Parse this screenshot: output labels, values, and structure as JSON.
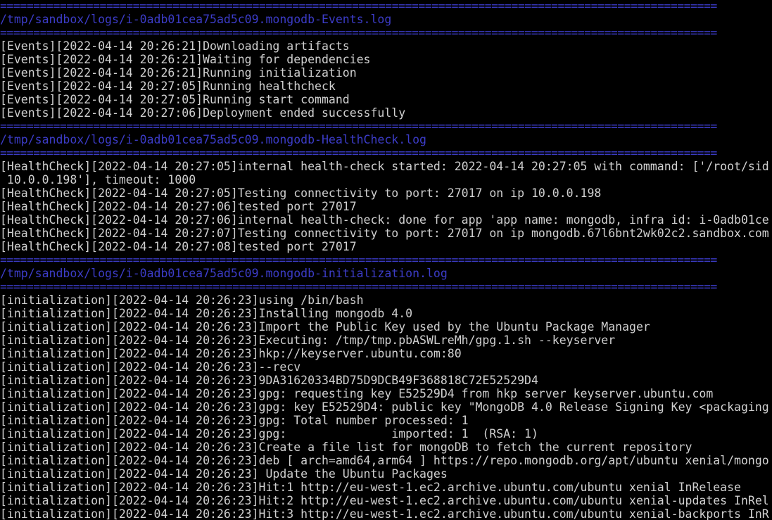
{
  "terminal": {
    "separator": "============================================================================================================",
    "lines": [
      {
        "type": "sep"
      },
      {
        "type": "path",
        "text": "/tmp/sandbox/logs/i-0adb01cea75ad5c09.mongodb-Events.log"
      },
      {
        "type": "sep"
      },
      {
        "type": "text",
        "text": "[Events][2022-04-14 20:26:21]Downloading artifacts"
      },
      {
        "type": "text",
        "text": "[Events][2022-04-14 20:26:21]Waiting for dependencies"
      },
      {
        "type": "text",
        "text": "[Events][2022-04-14 20:26:21]Running initialization"
      },
      {
        "type": "text",
        "text": "[Events][2022-04-14 20:27:05]Running healthcheck"
      },
      {
        "type": "text",
        "text": "[Events][2022-04-14 20:27:05]Running start command"
      },
      {
        "type": "text",
        "text": "[Events][2022-04-14 20:27:06]Deployment ended successfully"
      },
      {
        "type": "sep"
      },
      {
        "type": "path",
        "text": "/tmp/sandbox/logs/i-0adb01cea75ad5c09.mongodb-HealthCheck.log"
      },
      {
        "type": "sep"
      },
      {
        "type": "text",
        "text": "[HealthCheck][2022-04-14 20:27:05]internal health-check started: 2022-04-14 20:27:05 with command: ['/root/sid"
      },
      {
        "type": "text",
        "text": " 10.0.0.198'], timeout: 1000"
      },
      {
        "type": "text",
        "text": "[HealthCheck][2022-04-14 20:27:05]Testing connectivity to port: 27017 on ip 10.0.0.198"
      },
      {
        "type": "text",
        "text": "[HealthCheck][2022-04-14 20:27:06]tested port 27017"
      },
      {
        "type": "text",
        "text": "[HealthCheck][2022-04-14 20:27:06]internal health-check: done for app 'app name: mongodb, infra id: i-0adb01ce"
      },
      {
        "type": "text",
        "text": "[HealthCheck][2022-04-14 20:27:07]Testing connectivity to port: 27017 on ip mongodb.67l6bnt2wk02c2.sandbox.com"
      },
      {
        "type": "text",
        "text": "[HealthCheck][2022-04-14 20:27:08]tested port 27017"
      },
      {
        "type": "sep"
      },
      {
        "type": "path",
        "text": "/tmp/sandbox/logs/i-0adb01cea75ad5c09.mongodb-initialization.log"
      },
      {
        "type": "sep"
      },
      {
        "type": "text",
        "text": "[initialization][2022-04-14 20:26:23]using /bin/bash"
      },
      {
        "type": "text",
        "text": "[initialization][2022-04-14 20:26:23]Installing mongodb 4.0"
      },
      {
        "type": "text",
        "text": "[initialization][2022-04-14 20:26:23]Import the Public Key used by the Ubuntu Package Manager"
      },
      {
        "type": "text",
        "text": "[initialization][2022-04-14 20:26:23]Executing: /tmp/tmp.pbASWLreMh/gpg.1.sh --keyserver"
      },
      {
        "type": "text",
        "text": "[initialization][2022-04-14 20:26:23]hkp://keyserver.ubuntu.com:80"
      },
      {
        "type": "text",
        "text": "[initialization][2022-04-14 20:26:23]--recv"
      },
      {
        "type": "text",
        "text": "[initialization][2022-04-14 20:26:23]9DA31620334BD75D9DCB49F368818C72E52529D4"
      },
      {
        "type": "text",
        "text": "[initialization][2022-04-14 20:26:23]gpg: requesting key E52529D4 from hkp server keyserver.ubuntu.com"
      },
      {
        "type": "text",
        "text": "[initialization][2022-04-14 20:26:23]gpg: key E52529D4: public key \"MongoDB 4.0 Release Signing Key <packaging"
      },
      {
        "type": "text",
        "text": "[initialization][2022-04-14 20:26:23]gpg: Total number processed: 1"
      },
      {
        "type": "text",
        "text": "[initialization][2022-04-14 20:26:23]gpg:               imported: 1  (RSA: 1)"
      },
      {
        "type": "text",
        "text": "[initialization][2022-04-14 20:26:23]Create a file list for mongoDB to fetch the current repository"
      },
      {
        "type": "text",
        "text": "[initialization][2022-04-14 20:26:23]deb [ arch=amd64,arm64 ] https://repo.mongodb.org/apt/ubuntu xenial/mongo"
      },
      {
        "type": "text",
        "text": "[initialization][2022-04-14 20:26:23] Update the Ubuntu Packages"
      },
      {
        "type": "text",
        "text": "[initialization][2022-04-14 20:26:23]Hit:1 http://eu-west-1.ec2.archive.ubuntu.com/ubuntu xenial InRelease"
      },
      {
        "type": "text",
        "text": "[initialization][2022-04-14 20:26:23]Hit:2 http://eu-west-1.ec2.archive.ubuntu.com/ubuntu xenial-updates InRel"
      },
      {
        "type": "text",
        "text": "[initialization][2022-04-14 20:26:23]Hit:3 http://eu-west-1.ec2.archive.ubuntu.com/ubuntu xenial-backports InR"
      }
    ]
  },
  "colors": {
    "background": "#000000",
    "text": "#d0d0d0",
    "accent": "#3c3cc8"
  }
}
